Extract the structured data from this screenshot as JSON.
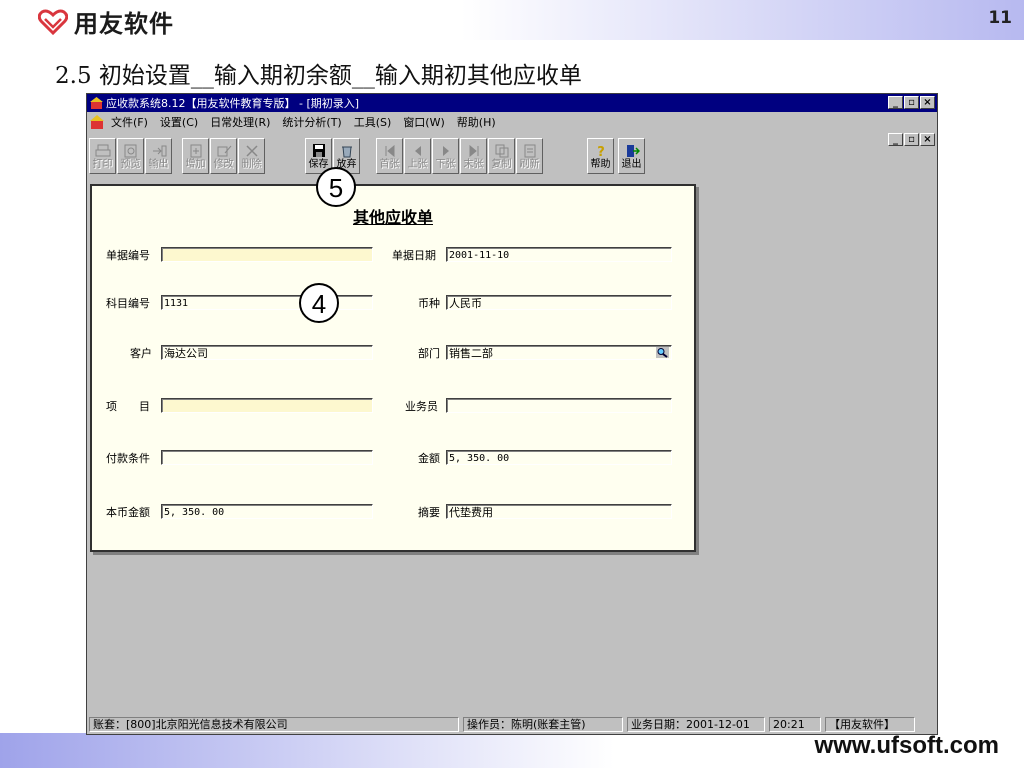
{
  "header": {
    "brand": "用友软件",
    "page_number": "11"
  },
  "slide_title": "2.5 初始设置__输入期初余额__输入期初其他应收单",
  "footer": {
    "website": "www.ufsoft.com"
  },
  "window": {
    "title": "应收款系统8.12【用友软件教育专版】 - [期初录入]",
    "menu": [
      "文件(F)",
      "设置(C)",
      "日常处理(R)",
      "统计分析(T)",
      "工具(S)",
      "窗口(W)",
      "帮助(H)"
    ],
    "toolbar": [
      {
        "label": "打印",
        "icon": "printer-icon",
        "enabled": false
      },
      {
        "label": "预览",
        "icon": "preview-icon",
        "enabled": false
      },
      {
        "label": "输出",
        "icon": "export-icon",
        "enabled": false
      },
      {
        "label": "增加",
        "icon": "add-icon",
        "enabled": false
      },
      {
        "label": "修改",
        "icon": "edit-icon",
        "enabled": false
      },
      {
        "label": "删除",
        "icon": "delete-icon",
        "enabled": false
      },
      {
        "label": "保存",
        "icon": "floppy-disk-icon",
        "enabled": true
      },
      {
        "label": "放弃",
        "icon": "trash-icon",
        "enabled": true
      },
      {
        "label": "首张",
        "icon": "first-icon",
        "enabled": false
      },
      {
        "label": "上张",
        "icon": "prev-icon",
        "enabled": false
      },
      {
        "label": "下张",
        "icon": "next-icon",
        "enabled": false
      },
      {
        "label": "末张",
        "icon": "last-icon",
        "enabled": false
      },
      {
        "label": "复制",
        "icon": "copy-icon",
        "enabled": false
      },
      {
        "label": "刷新",
        "icon": "refresh-icon",
        "enabled": false
      },
      {
        "label": "帮助",
        "icon": "help-icon",
        "enabled": true
      },
      {
        "label": "退出",
        "icon": "exit-icon",
        "enabled": true
      }
    ]
  },
  "form": {
    "title": "其他应收单",
    "fields": {
      "doc_no": {
        "label": "单据编号",
        "value": ""
      },
      "doc_date": {
        "label": "单据日期",
        "value": "2001-11-10"
      },
      "account_code": {
        "label": "科目编号",
        "value": "1131"
      },
      "currency": {
        "label": "币种",
        "value": "人民币"
      },
      "customer": {
        "label": "客户",
        "value": "海达公司"
      },
      "department": {
        "label": "部门",
        "value": "销售二部"
      },
      "project": {
        "label": "项　　目",
        "value": ""
      },
      "salesperson": {
        "label": "业务员",
        "value": ""
      },
      "payment_terms": {
        "label": "付款条件",
        "value": ""
      },
      "amount": {
        "label": "金额",
        "value": "5, 350. 00"
      },
      "local_amount": {
        "label": "本币金额",
        "value": "5, 350. 00"
      },
      "summary": {
        "label": "摘要",
        "value": "代垫费用"
      }
    }
  },
  "status_bar": {
    "account_set": "账套：[800]北京阳光信息技术有限公司",
    "operator": "操作员：陈明(账套主管)",
    "business_date": "业务日期：2001-12-01",
    "time": "20:21",
    "brand": "【用友软件】"
  },
  "callouts": [
    "5",
    "4"
  ],
  "colors": {
    "title_bar": "#000080",
    "window_bg": "#c0c0c0",
    "form_bg": "#fffff0",
    "brand_red": "#d9363e"
  }
}
